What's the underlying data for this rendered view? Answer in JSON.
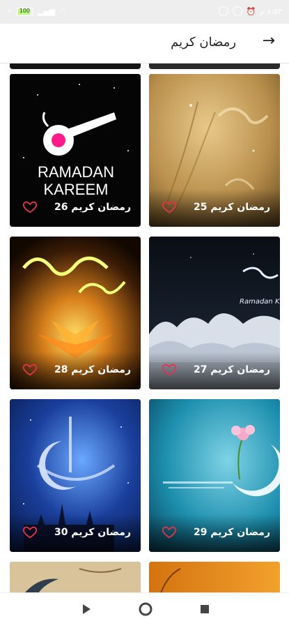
{
  "status_bar": {
    "battery_level": "100",
    "time": "٨:٥٣ م"
  },
  "header": {
    "title": "رمضان كريم"
  },
  "cards": [
    {
      "label": "رمضان كريم 25",
      "art_text": ""
    },
    {
      "label": "رمضان كريم 26",
      "art_text": "RAMADAN KAREEM"
    },
    {
      "label": "رمضان كريم 27",
      "art_text": "Ramadan K"
    },
    {
      "label": "رمضان كريم 28",
      "art_text": ""
    },
    {
      "label": "رمضان كريم 29",
      "art_text": ""
    },
    {
      "label": "رمضان كريم 30",
      "art_text": ""
    }
  ],
  "colors": {
    "accent_heart": "#e0344b",
    "pink_circle": "#ff1a8c"
  },
  "icons": [
    "back-arrow-icon",
    "heart-icon",
    "back-triangle-icon",
    "home-circle-icon",
    "recents-square-icon"
  ]
}
